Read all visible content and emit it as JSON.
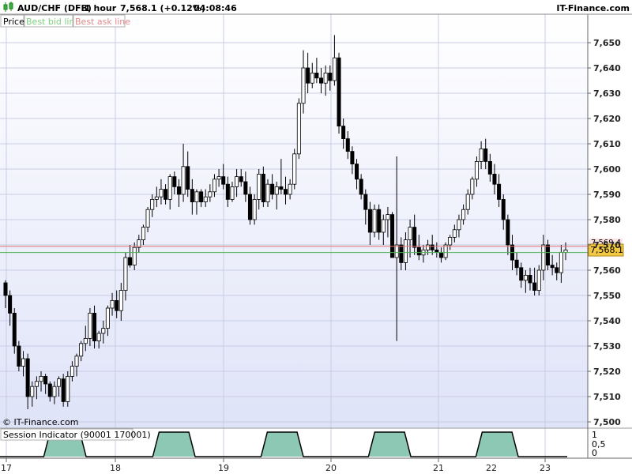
{
  "header": {
    "symbol": "AUD/CHF (DFB)",
    "timeframe": "1 hour",
    "price_change": "7,568.1 (+0.12%)",
    "time": "04:08:46",
    "brand": "IT-Finance.com",
    "icon": "candlestick-chart-icon"
  },
  "legend": {
    "price_label": "Price",
    "bid_label": "Best bid line",
    "ask_label": "Best ask line"
  },
  "copyright": "© IT-Finance.com",
  "indicator": {
    "title": "Session Indicator (90001 170001)",
    "ticks": [
      "1",
      "0,5",
      "0"
    ]
  },
  "colors": {
    "bg_top": "#ffffff",
    "bg_bottom": "#dfe3f8",
    "bid_line": "#4caf50",
    "ask_line": "#e57373",
    "price_tag": "#f3c842",
    "session_fill": "#8dc8b4",
    "candle_up": "#ffffff",
    "candle_down": "#000000"
  },
  "chart_data": {
    "type": "candlestick",
    "title": "AUD/CHF (DFB) 1 hour",
    "ylim": [
      7500,
      7655
    ],
    "y_ticks": [
      "7,500",
      "7,510",
      "7,520",
      "7,530",
      "7,540",
      "7,550",
      "7,560",
      "7,570",
      "7,580",
      "7,590",
      "7,600",
      "7,610",
      "7,620",
      "7,630",
      "7,640",
      "7,650"
    ],
    "x_ticks": [
      "17",
      "18",
      "19",
      "20",
      "21",
      "22",
      "23"
    ],
    "last_price": "7,568.1",
    "ask_price": "7,569.4",
    "bid_price": "7,567.0",
    "session_periods": [
      {
        "start": "17 09:00",
        "end": "17 17:00"
      },
      {
        "start": "18 09:00",
        "end": "18 17:00"
      },
      {
        "start": "19 09:00",
        "end": "19 17:00"
      },
      {
        "start": "20 09:00",
        "end": "20 17:00"
      },
      {
        "start": "21 09:00",
        "end": "21 17:00"
      }
    ],
    "ohlc": [
      [
        7555,
        7556,
        7545,
        7550
      ],
      [
        7550,
        7552,
        7538,
        7543
      ],
      [
        7543,
        7545,
        7527,
        7530
      ],
      [
        7530,
        7532,
        7520,
        7522
      ],
      [
        7522,
        7528,
        7518,
        7525
      ],
      [
        7525,
        7527,
        7505,
        7510
      ],
      [
        7510,
        7516,
        7506,
        7514
      ],
      [
        7514,
        7518,
        7509,
        7516
      ],
      [
        7516,
        7520,
        7512,
        7518
      ],
      [
        7518,
        7519,
        7511,
        7515
      ],
      [
        7515,
        7516,
        7508,
        7510
      ],
      [
        7510,
        7516,
        7507,
        7514
      ],
      [
        7514,
        7518,
        7510,
        7517
      ],
      [
        7517,
        7519,
        7506,
        7508
      ],
      [
        7508,
        7520,
        7506,
        7518
      ],
      [
        7518,
        7524,
        7516,
        7522
      ],
      [
        7522,
        7527,
        7518,
        7526
      ],
      [
        7526,
        7532,
        7524,
        7531
      ],
      [
        7531,
        7538,
        7528,
        7533
      ],
      [
        7533,
        7545,
        7530,
        7543
      ],
      [
        7543,
        7546,
        7529,
        7532
      ],
      [
        7532,
        7536,
        7529,
        7535
      ],
      [
        7535,
        7540,
        7531,
        7537
      ],
      [
        7537,
        7546,
        7534,
        7545
      ],
      [
        7545,
        7551,
        7542,
        7548
      ],
      [
        7548,
        7552,
        7541,
        7544
      ],
      [
        7544,
        7555,
        7540,
        7552
      ],
      [
        7552,
        7567,
        7548,
        7565
      ],
      [
        7565,
        7570,
        7561,
        7562
      ],
      [
        7562,
        7571,
        7560,
        7569
      ],
      [
        7569,
        7574,
        7567,
        7572
      ],
      [
        7572,
        7578,
        7570,
        7577
      ],
      [
        7577,
        7585,
        7575,
        7584
      ],
      [
        7584,
        7590,
        7581,
        7588
      ],
      [
        7588,
        7593,
        7585,
        7589
      ],
      [
        7589,
        7596,
        7586,
        7592
      ],
      [
        7592,
        7594,
        7586,
        7588
      ],
      [
        7588,
        7598,
        7584,
        7597
      ],
      [
        7597,
        7599,
        7590,
        7593
      ],
      [
        7593,
        7596,
        7585,
        7590
      ],
      [
        7590,
        7610,
        7587,
        7601
      ],
      [
        7601,
        7607,
        7589,
        7592
      ],
      [
        7592,
        7596,
        7582,
        7587
      ],
      [
        7587,
        7592,
        7582,
        7591
      ],
      [
        7591,
        7592,
        7585,
        7587
      ],
      [
        7587,
        7592,
        7585,
        7589
      ],
      [
        7589,
        7594,
        7587,
        7591
      ],
      [
        7591,
        7598,
        7589,
        7596
      ],
      [
        7596,
        7600,
        7593,
        7597
      ],
      [
        7597,
        7602,
        7592,
        7594
      ],
      [
        7594,
        7597,
        7585,
        7588
      ],
      [
        7588,
        7595,
        7587,
        7593
      ],
      [
        7593,
        7600,
        7589,
        7597
      ],
      [
        7597,
        7600,
        7593,
        7595
      ],
      [
        7595,
        7599,
        7587,
        7590
      ],
      [
        7590,
        7593,
        7578,
        7580
      ],
      [
        7580,
        7590,
        7578,
        7588
      ],
      [
        7588,
        7600,
        7584,
        7598
      ],
      [
        7598,
        7601,
        7585,
        7587
      ],
      [
        7587,
        7596,
        7585,
        7594
      ],
      [
        7594,
        7598,
        7588,
        7590
      ],
      [
        7590,
        7595,
        7584,
        7593
      ],
      [
        7593,
        7604,
        7590,
        7592
      ],
      [
        7592,
        7597,
        7586,
        7590
      ],
      [
        7590,
        7596,
        7588,
        7594
      ],
      [
        7594,
        7608,
        7592,
        7606
      ],
      [
        7606,
        7628,
        7604,
        7626
      ],
      [
        7626,
        7647,
        7622,
        7640
      ],
      [
        7640,
        7646,
        7630,
        7634
      ],
      [
        7634,
        7642,
        7632,
        7638
      ],
      [
        7638,
        7644,
        7634,
        7636
      ],
      [
        7636,
        7640,
        7630,
        7634
      ],
      [
        7634,
        7641,
        7629,
        7638
      ],
      [
        7638,
        7641,
        7631,
        7635
      ],
      [
        7635,
        7653,
        7633,
        7644
      ],
      [
        7644,
        7646,
        7614,
        7617
      ],
      [
        7617,
        7620,
        7608,
        7612
      ],
      [
        7612,
        7615,
        7604,
        7607
      ],
      [
        7607,
        7609,
        7598,
        7602
      ],
      [
        7602,
        7604,
        7592,
        7596
      ],
      [
        7596,
        7598,
        7588,
        7590
      ],
      [
        7590,
        7592,
        7578,
        7584
      ],
      [
        7584,
        7587,
        7570,
        7575
      ],
      [
        7575,
        7586,
        7573,
        7584
      ],
      [
        7584,
        7586,
        7572,
        7575
      ],
      [
        7575,
        7582,
        7570,
        7580
      ],
      [
        7580,
        7585,
        7573,
        7582
      ],
      [
        7582,
        7583,
        7567,
        7565
      ],
      [
        7565,
        7605,
        7532,
        7570
      ],
      [
        7570,
        7573,
        7560,
        7563
      ],
      [
        7563,
        7575,
        7560,
        7572
      ],
      [
        7572,
        7580,
        7565,
        7577
      ],
      [
        7577,
        7582,
        7566,
        7569
      ],
      [
        7569,
        7574,
        7564,
        7566
      ],
      [
        7566,
        7570,
        7563,
        7568
      ],
      [
        7568,
        7572,
        7566,
        7570
      ],
      [
        7570,
        7574,
        7566,
        7568
      ],
      [
        7568,
        7571,
        7565,
        7567
      ],
      [
        7567,
        7569,
        7563,
        7565
      ],
      [
        7565,
        7571,
        7564,
        7570
      ],
      [
        7570,
        7574,
        7568,
        7573
      ],
      [
        7573,
        7578,
        7571,
        7576
      ],
      [
        7576,
        7582,
        7573,
        7580
      ],
      [
        7580,
        7586,
        7578,
        7584
      ],
      [
        7584,
        7592,
        7582,
        7590
      ],
      [
        7590,
        7597,
        7588,
        7596
      ],
      [
        7596,
        7605,
        7593,
        7603
      ],
      [
        7603,
        7611,
        7600,
        7608
      ],
      [
        7608,
        7612,
        7600,
        7603
      ],
      [
        7603,
        7606,
        7595,
        7598
      ],
      [
        7598,
        7602,
        7590,
        7594
      ],
      [
        7594,
        7598,
        7585,
        7588
      ],
      [
        7588,
        7590,
        7576,
        7580
      ],
      [
        7580,
        7582,
        7566,
        7570
      ],
      [
        7570,
        7574,
        7560,
        7564
      ],
      [
        7564,
        7567,
        7558,
        7561
      ],
      [
        7561,
        7563,
        7553,
        7556
      ],
      [
        7556,
        7560,
        7551,
        7558
      ],
      [
        7558,
        7561,
        7552,
        7555
      ],
      [
        7555,
        7561,
        7550,
        7552
      ],
      [
        7552,
        7562,
        7550,
        7560
      ],
      [
        7560,
        7574,
        7556,
        7570
      ],
      [
        7570,
        7572,
        7560,
        7562
      ],
      [
        7562,
        7566,
        7558,
        7561
      ],
      [
        7561,
        7563,
        7556,
        7559
      ],
      [
        7559,
        7570,
        7555,
        7567
      ],
      [
        7567,
        7571,
        7564,
        7568
      ]
    ]
  }
}
